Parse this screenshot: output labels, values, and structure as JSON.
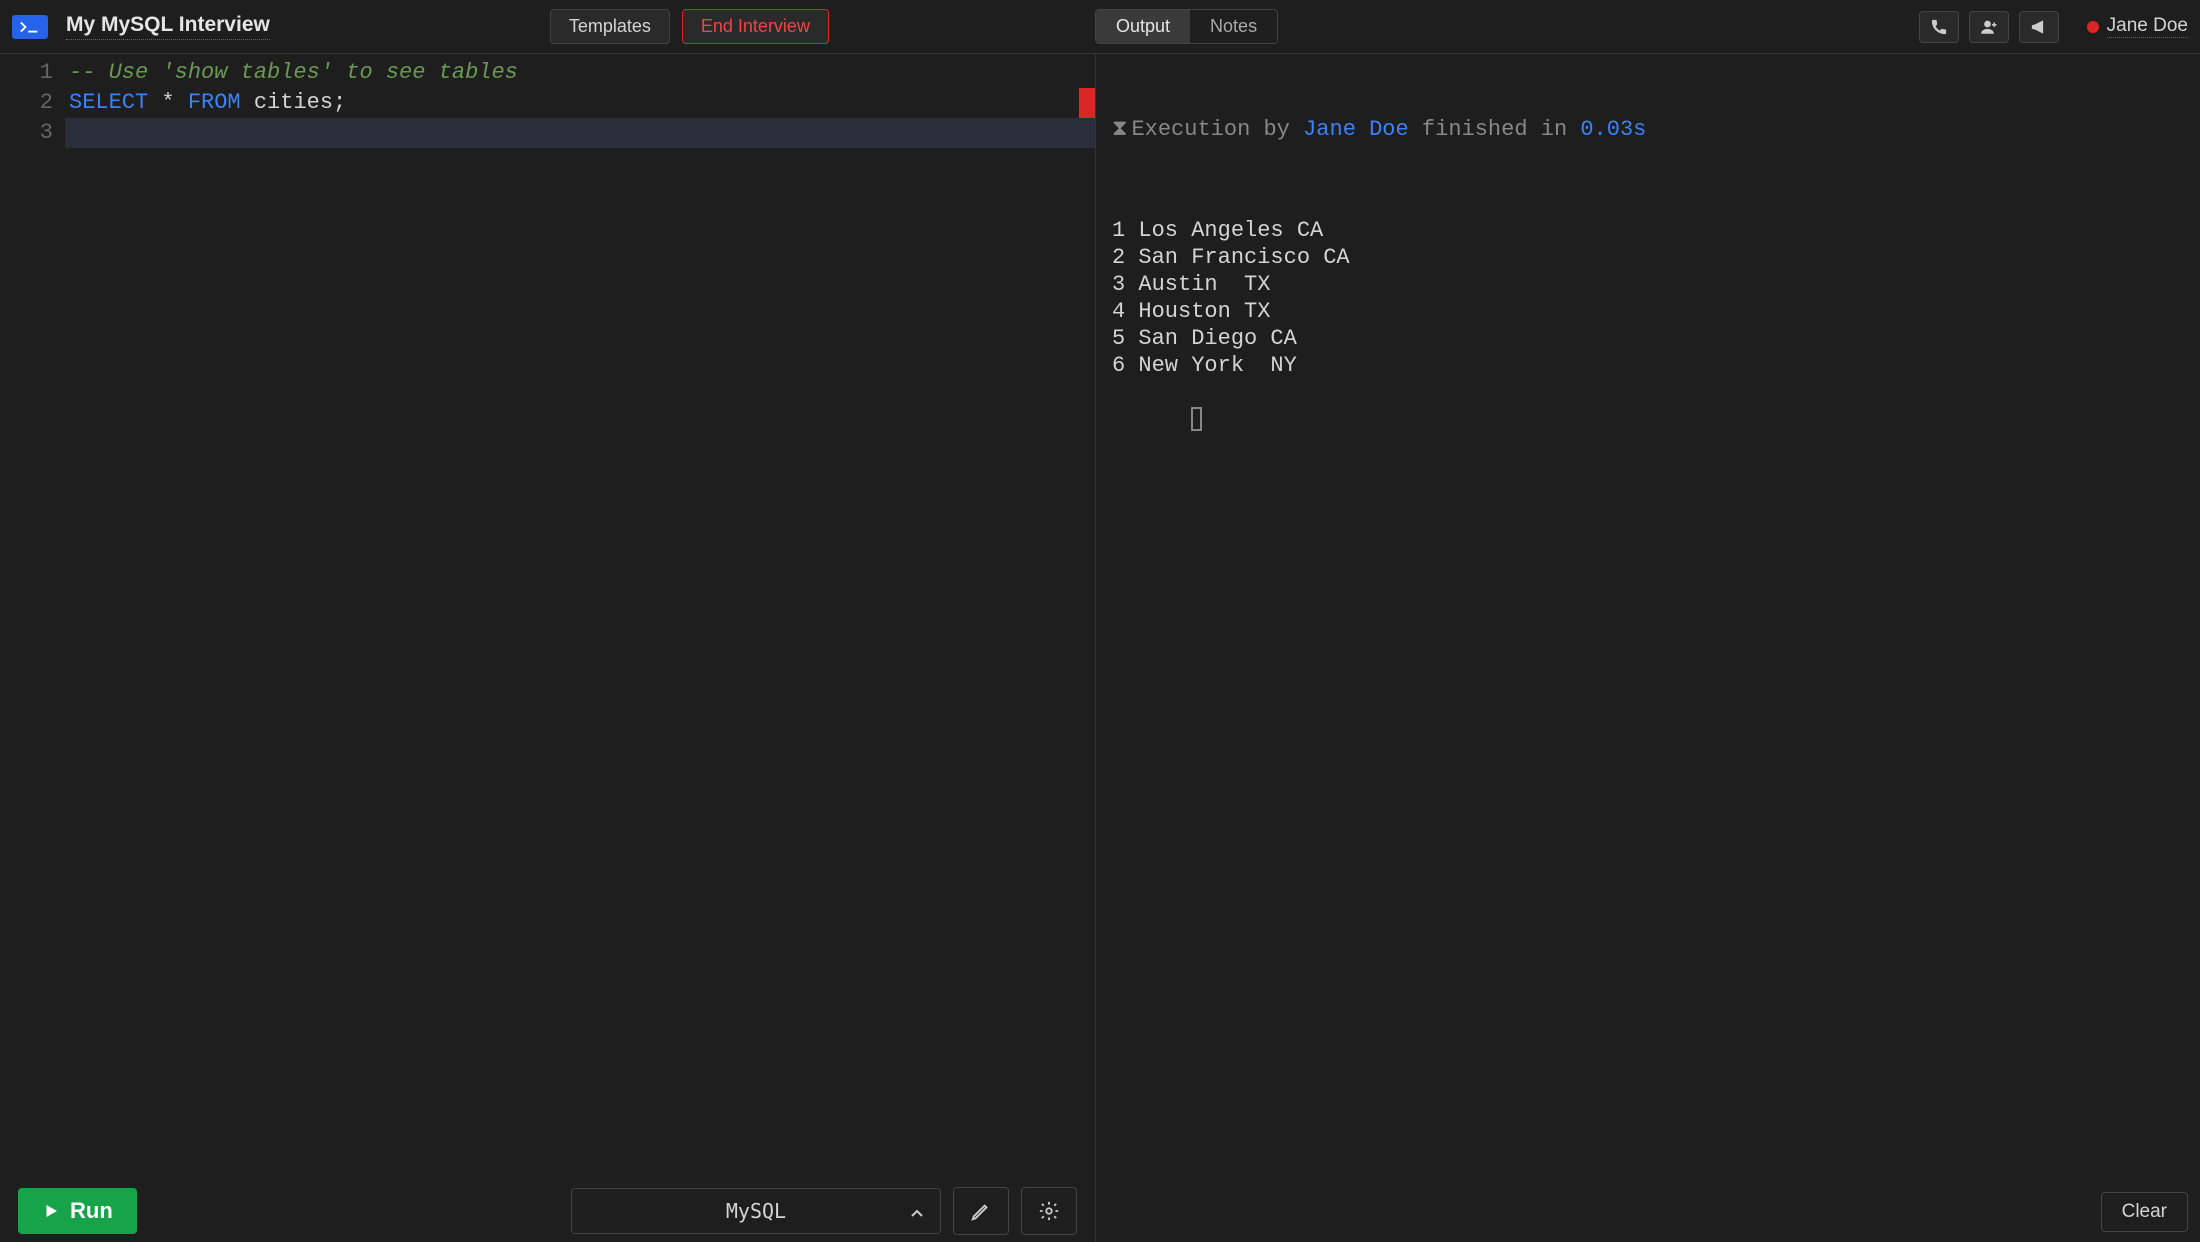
{
  "header": {
    "title": "My MySQL Interview",
    "templates_label": "Templates",
    "end_interview_label": "End Interview",
    "tabs": {
      "output": "Output",
      "notes": "Notes"
    },
    "username": "Jane Doe"
  },
  "editor": {
    "lines": [
      {
        "num": "1",
        "tokens": [
          {
            "cls": "comment",
            "text": "-- Use 'show tables' to see tables"
          }
        ]
      },
      {
        "num": "2",
        "tokens": [
          {
            "cls": "keyword",
            "text": "SELECT"
          },
          {
            "cls": "",
            "text": " * "
          },
          {
            "cls": "keyword",
            "text": "FROM"
          },
          {
            "cls": "",
            "text": " cities;"
          }
        ]
      },
      {
        "num": "3",
        "tokens": []
      }
    ],
    "run_label": "Run",
    "language": "MySQL"
  },
  "output": {
    "exec": {
      "prefix": "Execution by ",
      "user": "Jane Doe",
      "middle": " finished in ",
      "time": "0.03s"
    },
    "rows": [
      "1 Los Angeles CA",
      "2 San Francisco CA",
      "3 Austin  TX",
      "4 Houston TX",
      "5 San Diego CA",
      "6 New York  NY"
    ],
    "clear_label": "Clear"
  }
}
